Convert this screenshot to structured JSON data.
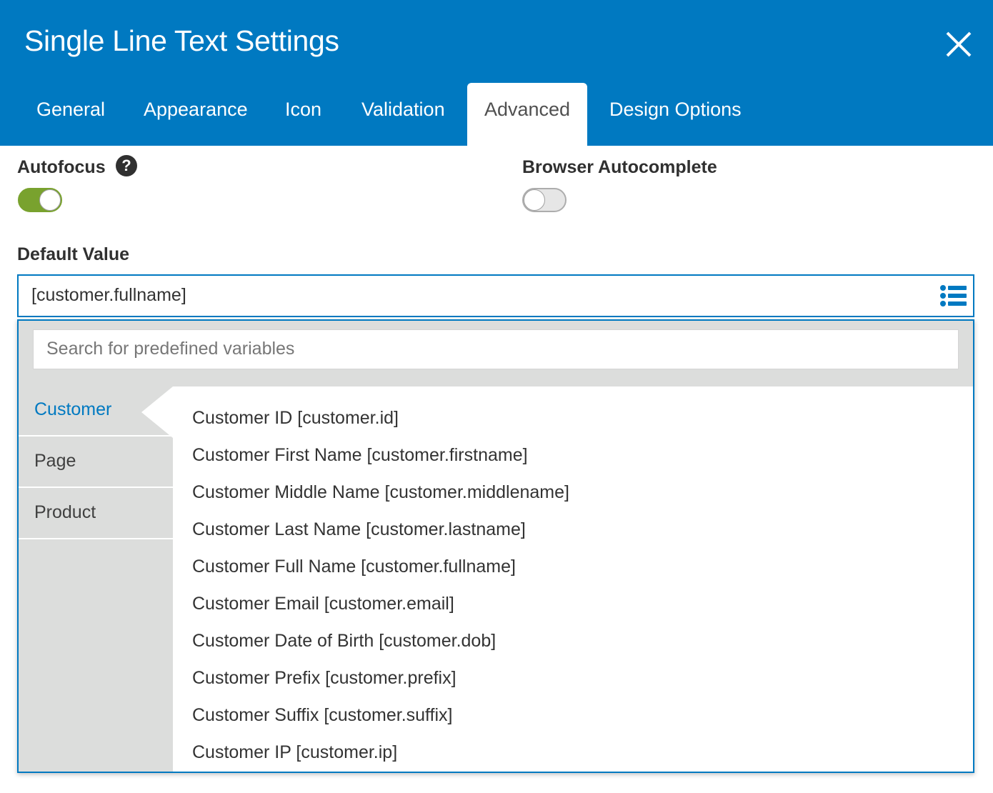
{
  "dialog": {
    "title": "Single Line Text Settings",
    "close_icon": "close-icon"
  },
  "tabs": [
    {
      "label": "General"
    },
    {
      "label": "Appearance"
    },
    {
      "label": "Icon"
    },
    {
      "label": "Validation"
    },
    {
      "label": "Advanced",
      "active": true
    },
    {
      "label": "Design Options"
    }
  ],
  "autofocus": {
    "label": "Autofocus",
    "help_icon": "question-circle-icon",
    "help_symbol": "?",
    "enabled": true
  },
  "browser_autocomplete": {
    "label": "Browser Autocomplete",
    "enabled": false
  },
  "default_value": {
    "label": "Default Value",
    "value": "[customer.fullname]",
    "variables_icon": "list-icon"
  },
  "variables_dropdown": {
    "search_placeholder": "Search for predefined variables",
    "categories": [
      {
        "label": "Customer",
        "active": true
      },
      {
        "label": "Page"
      },
      {
        "label": "Product"
      }
    ],
    "items": [
      "Customer ID [customer.id]",
      "Customer First Name [customer.firstname]",
      "Customer Middle Name [customer.middlename]",
      "Customer Last Name [customer.lastname]",
      "Customer Full Name [customer.fullname]",
      "Customer Email [customer.email]",
      "Customer Date of Birth [customer.dob]",
      "Customer Prefix [customer.prefix]",
      "Customer Suffix [customer.suffix]",
      "Customer IP [customer.ip]"
    ]
  },
  "colors": {
    "header_blue": "#0079c1",
    "toggle_on": "#79a22e",
    "dropdown_gray": "#dcdddc"
  }
}
